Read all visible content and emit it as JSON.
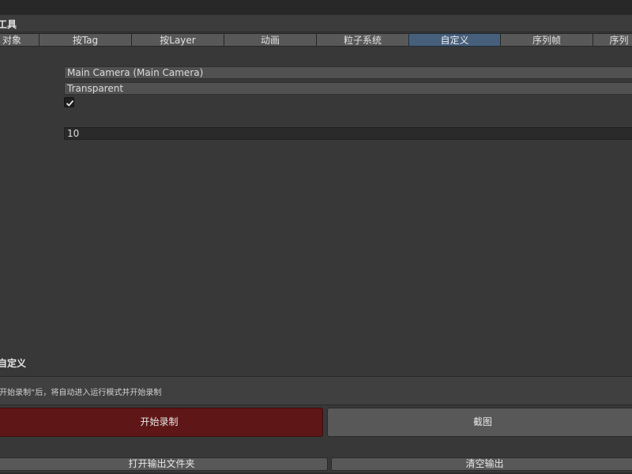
{
  "window": {
    "title": "工具"
  },
  "tabs": [
    {
      "label": "对象",
      "active": false
    },
    {
      "label": "按Tag",
      "active": false
    },
    {
      "label": "按Layer",
      "active": false
    },
    {
      "label": "动画",
      "active": false
    },
    {
      "label": "粒子系统",
      "active": false
    },
    {
      "label": "自定义",
      "active": true
    },
    {
      "label": "序列帧",
      "active": false
    },
    {
      "label": "序列",
      "active": false
    }
  ],
  "settings": {
    "camera_value": "Main Camera (Main Camera)",
    "background_value": "Transparent",
    "checkbox_checked": true,
    "number_value": "10"
  },
  "section": {
    "title": "自定义"
  },
  "help": {
    "text": "“开始录制”后，将自动进入运行模式并开始录制"
  },
  "buttons": {
    "record": "开始录制",
    "screenshot": "截图",
    "open_output": "打开输出文件夹",
    "clear_output": "清空输出"
  },
  "colors": {
    "background": "#383838",
    "active_tab": "#46607c",
    "record_button": "#5e1616"
  }
}
